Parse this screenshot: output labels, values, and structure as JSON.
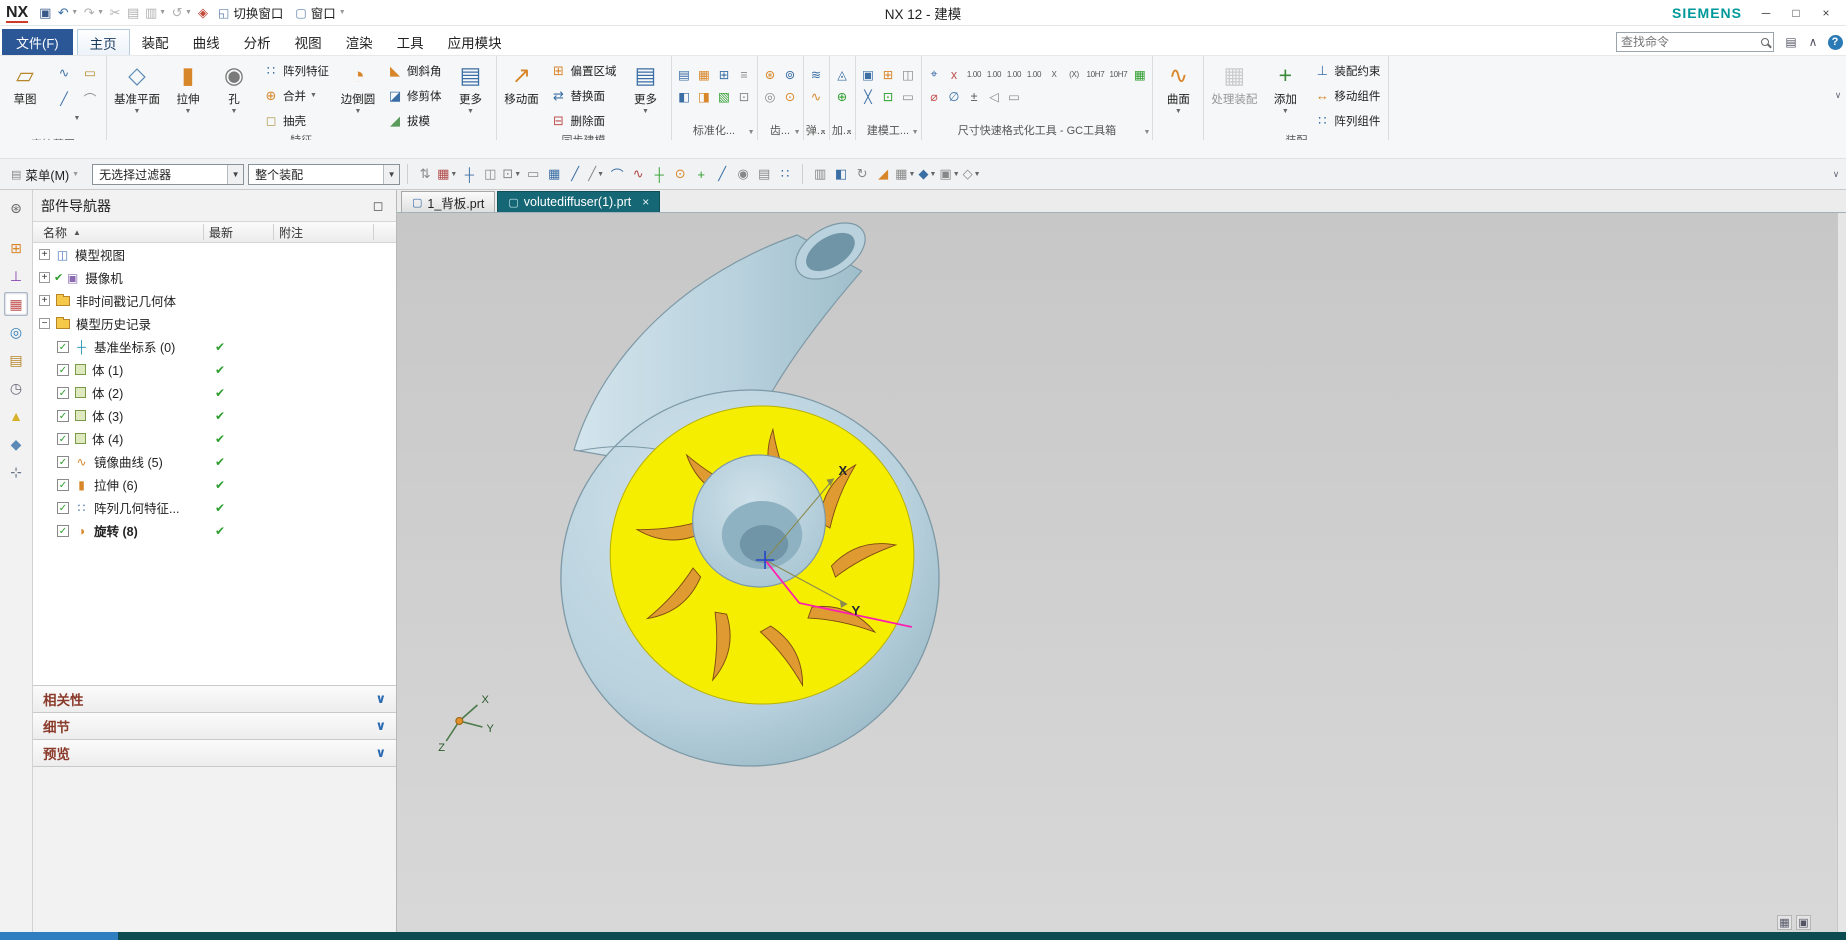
{
  "colors": {
    "brand_teal": "#009999",
    "file_tab_blue": "#2b5797",
    "active_doc_tab": "#156775",
    "check_green": "#2e9e2e",
    "statusbar_teal": "#0d4a52",
    "statusbar_blue": "#2f7fc0",
    "model_body": "#b9d2de",
    "model_body_edge": "#7d99a6",
    "model_face_yellow": "#f6ee00",
    "model_face_edge": "#b8b200",
    "model_blade_orange": "#e09a32",
    "model_blade_edge": "#7a4a12",
    "model_bore": "#6f95a6",
    "highlight_magenta": "#ff1fae"
  },
  "titlebar": {
    "logo": "NX",
    "title": "NX 12 - 建模",
    "brand": "SIEMENS",
    "switch_window": "切换窗口",
    "window_menu": "窗口",
    "controls": [
      "─",
      "□",
      "×"
    ],
    "qat_icons": [
      {
        "name": "save-icon",
        "g": "▣",
        "c": "#3a5a8a"
      },
      {
        "name": "undo-icon",
        "g": "↶",
        "c": "#3a6ea5",
        "caret": true
      },
      {
        "name": "redo-icon",
        "g": "↷",
        "c": "#b0b0b0",
        "caret": true
      },
      {
        "name": "cut-icon",
        "g": "✂",
        "c": "#b0b0b0"
      },
      {
        "name": "copy-icon",
        "g": "▤",
        "c": "#b0b0b0"
      },
      {
        "name": "paste-icon",
        "g": "▥",
        "c": "#b0b0b0",
        "caret": true
      },
      {
        "name": "repeat-command-icon",
        "g": "↺",
        "c": "#b0b0b0",
        "caret": true
      },
      {
        "name": "command-finder-icon",
        "g": "◈",
        "c": "#c04a3a"
      }
    ]
  },
  "tabrow": {
    "file": "文件(F)",
    "tabs": [
      "主页",
      "装配",
      "曲线",
      "分析",
      "视图",
      "渲染",
      "工具",
      "应用模块"
    ],
    "active": "主页",
    "search_placeholder": "查找命令",
    "right_icons": [
      {
        "name": "clipboard-icon",
        "g": "▤"
      },
      {
        "name": "minimize-ribbon-icon",
        "g": "∧"
      },
      {
        "name": "help-icon",
        "g": "?"
      }
    ]
  },
  "ribbon": {
    "groups": [
      {
        "label": "直接草图",
        "caret": true,
        "items": [
          {
            "type": "big",
            "label": "草图",
            "glyph": "▱",
            "color": "#b5862a"
          },
          {
            "type": "grid",
            "icons": [
              {
                "g": "∿",
                "c": "#3a6ea5"
              },
              {
                "g": "▭",
                "c": "#b5862a"
              },
              {
                "g": "╱",
                "c": "#3a6ea5"
              },
              {
                "g": "⌒",
                "c": "#888888"
              }
            ]
          }
        ]
      },
      {
        "label": "特征",
        "caret": true,
        "items": [
          {
            "type": "big",
            "label": "基准平面",
            "glyph": "◇",
            "color": "#5a8ab5",
            "caret": true
          },
          {
            "type": "big",
            "label": "拉伸",
            "glyph": "▮",
            "color": "#d8862a",
            "caret": true
          },
          {
            "type": "big",
            "label": "孔",
            "glyph": "◉",
            "color": "#7a7a7a",
            "caret": true
          },
          {
            "type": "stack",
            "items": [
              {
                "label": "阵列特征",
                "g": "∷",
                "c": "#3a6ea5"
              },
              {
                "label": "合并",
                "g": "⊕",
                "c": "#d8862a",
                "caret": true
              },
              {
                "label": "抽壳",
                "g": "◻",
                "c": "#b5a05a"
              }
            ]
          },
          {
            "type": "big",
            "label": "边倒圆",
            "glyph": "◔",
            "color": "#d8862a",
            "caret": true
          },
          {
            "type": "stack",
            "items": [
              {
                "label": "倒斜角",
                "g": "◣",
                "c": "#d8862a"
              },
              {
                "label": "修剪体",
                "g": "◪",
                "c": "#3a6ea5"
              },
              {
                "label": "拔模",
                "g": "◢",
                "c": "#5a9a5a"
              }
            ]
          },
          {
            "type": "big",
            "label": "更多",
            "glyph": "▤",
            "color": "#3a6ea5",
            "caret": true
          }
        ]
      },
      {
        "label": "同步建模",
        "caret": true,
        "items": [
          {
            "type": "big",
            "label": "移动面",
            "glyph": "↗",
            "color": "#d8862a"
          },
          {
            "type": "stack",
            "items": [
              {
                "label": "偏置区域",
                "g": "⊞",
                "c": "#d8862a"
              },
              {
                "label": "替换面",
                "g": "⇄",
                "c": "#3a6ea5"
              },
              {
                "label": "删除面",
                "g": "⊟",
                "c": "#c05050"
              }
            ]
          },
          {
            "type": "big",
            "label": "更多",
            "glyph": "▤",
            "color": "#3a6ea5",
            "caret": true
          }
        ]
      },
      {
        "label": "标准化...",
        "caret": true,
        "items": [
          {
            "type": "minis",
            "rows": [
              [
                {
                  "g": "▤",
                  "c": "#3a6ea5"
                },
                {
                  "g": "▦",
                  "c": "#d8862a"
                },
                {
                  "g": "⊞",
                  "c": "#3a6ea5"
                },
                {
                  "g": "≡",
                  "c": "#888888"
                }
              ],
              [
                {
                  "g": "◧",
                  "c": "#3a6ea5"
                },
                {
                  "g": "◨",
                  "c": "#d8862a"
                },
                {
                  "g": "▧",
                  "c": "#2e9e2e"
                },
                {
                  "g": "⊡",
                  "c": "#888888"
                }
              ]
            ]
          }
        ]
      },
      {
        "label": "齿...",
        "caret": true,
        "items": [
          {
            "type": "minis",
            "rows": [
              [
                {
                  "g": "⊛",
                  "c": "#d8862a"
                },
                {
                  "g": "⊚",
                  "c": "#3a6ea5"
                }
              ],
              [
                {
                  "g": "◎",
                  "c": "#888888"
                },
                {
                  "g": "⊙",
                  "c": "#d8862a"
                }
              ]
            ]
          }
        ]
      },
      {
        "label": "弹...",
        "caret": true,
        "items": [
          {
            "type": "minis",
            "rows": [
              [
                {
                  "g": "≋",
                  "c": "#3a6ea5"
                }
              ],
              [
                {
                  "g": "∿",
                  "c": "#d8862a"
                }
              ]
            ]
          }
        ]
      },
      {
        "label": "加...",
        "caret": true,
        "items": [
          {
            "type": "minis",
            "rows": [
              [
                {
                  "g": "◬",
                  "c": "#3a6ea5"
                }
              ],
              [
                {
                  "g": "⊕",
                  "c": "#2e9e2e"
                }
              ]
            ]
          }
        ]
      },
      {
        "label": "建模工...",
        "caret": true,
        "items": [
          {
            "type": "minis",
            "rows": [
              [
                {
                  "g": "▣",
                  "c": "#3a6ea5"
                },
                {
                  "g": "⊞",
                  "c": "#d8862a"
                },
                {
                  "g": "◫",
                  "c": "#888888"
                }
              ],
              [
                {
                  "g": "╳",
                  "c": "#3a6ea5"
                },
                {
                  "g": "⊡",
                  "c": "#2e9e2e"
                },
                {
                  "g": "▭",
                  "c": "#888888"
                }
              ]
            ]
          }
        ]
      },
      {
        "label": "尺寸快速格式化工具 - GC工具箱",
        "caret": true,
        "items": [
          {
            "type": "minis",
            "rows": [
              [
                {
                  "g": "⌖",
                  "c": "#3a6ea5"
                },
                {
                  "g": "x",
                  "c": "#c05050"
                },
                {
                  "g": "1.00",
                  "c": "#555",
                  "t": 1
                },
                {
                  "g": "1.00",
                  "c": "#555",
                  "t": 1
                },
                {
                  "g": "1.00",
                  "c": "#555",
                  "t": 1
                },
                {
                  "g": "1.00",
                  "c": "#555",
                  "t": 1
                },
                {
                  "g": "X",
                  "c": "#555",
                  "t": 1
                },
                {
                  "g": "(X)",
                  "c": "#555",
                  "t": 1
                },
                {
                  "g": "10H7",
                  "c": "#555",
                  "t": 1
                },
                {
                  "g": "10H7",
                  "c": "#555",
                  "t": 1
                },
                {
                  "g": "▦",
                  "c": "#2e9e2e"
                }
              ],
              [
                {
                  "g": "⌀",
                  "c": "#c05050"
                },
                {
                  "g": "∅",
                  "c": "#3a6ea5"
                },
                {
                  "g": "±",
                  "c": "#555555"
                },
                {
                  "g": "◁",
                  "c": "#888888"
                },
                {
                  "g": "▭",
                  "c": "#888888"
                }
              ]
            ]
          }
        ]
      },
      {
        "label": "",
        "items": [
          {
            "type": "big",
            "label": "曲面",
            "glyph": "∿",
            "color": "#d8862a",
            "caret": true
          }
        ]
      },
      {
        "label": "装配",
        "caret": true,
        "items": [
          {
            "type": "big",
            "label": "处理装配",
            "glyph": "▦",
            "color": "#999999",
            "disabled": true
          },
          {
            "type": "big",
            "label": "添加",
            "glyph": "+",
            "color": "#3a8a3a",
            "caret": true
          },
          {
            "type": "stack",
            "items": [
              {
                "label": "装配约束",
                "g": "⊥",
                "c": "#3a6ea5"
              },
              {
                "label": "移动组件",
                "g": "↔",
                "c": "#d8862a"
              },
              {
                "label": "阵列组件",
                "g": "∷",
                "c": "#3a6ea5"
              }
            ]
          }
        ]
      }
    ]
  },
  "toolrow": {
    "menu": "菜单(M)",
    "filter": "无选择过滤器",
    "scope": "整个装配",
    "icons1": [
      {
        "g": "⇅",
        "c": "#888888"
      },
      {
        "g": "▦",
        "c": "#b04a4a",
        "caret": true
      },
      {
        "g": "┼",
        "c": "#3a6ea5"
      },
      {
        "g": "◫",
        "c": "#888888"
      },
      {
        "g": "⊡",
        "c": "#888888",
        "caret": true
      },
      {
        "g": "▭",
        "c": "#888888"
      },
      {
        "g": "▦",
        "c": "#3a6ea5"
      },
      {
        "g": "╱",
        "c": "#3a6ea5"
      },
      {
        "g": "╱",
        "c": "#888888",
        "caret": true
      },
      {
        "g": "⌒",
        "c": "#3a6ea5"
      },
      {
        "g": "∿",
        "c": "#b04a4a"
      },
      {
        "g": "┼",
        "c": "#2e9e2e"
      },
      {
        "g": "⊙",
        "c": "#d8862a"
      },
      {
        "g": "+",
        "c": "#2e9e2e"
      },
      {
        "g": "╱",
        "c": "#3a6ea5"
      },
      {
        "g": "◉",
        "c": "#888888"
      },
      {
        "g": "▤",
        "c": "#888888"
      },
      {
        "g": "∷",
        "c": "#3a6ea5"
      }
    ],
    "icons2": [
      {
        "g": "▥",
        "c": "#888888"
      },
      {
        "g": "◧",
        "c": "#3a6ea5"
      },
      {
        "g": "↻",
        "c": "#888888"
      },
      {
        "g": "◢",
        "c": "#d8862a"
      },
      {
        "g": "▦",
        "c": "#888888",
        "caret": true
      },
      {
        "g": "◆",
        "c": "#3a6ea5",
        "caret": true
      },
      {
        "g": "▣",
        "c": "#888888",
        "caret": true
      },
      {
        "g": "◇",
        "c": "#888888",
        "caret": true
      }
    ]
  },
  "sidebar": {
    "icons": [
      {
        "name": "navigator-settings-gear-icon",
        "g": "⊛",
        "c": "#666666",
        "gear": true
      },
      {
        "name": "assembly-navigator-icon",
        "g": "⊞",
        "c": "#d8862a"
      },
      {
        "name": "constraint-navigator-icon",
        "g": "⊥",
        "c": "#8a4ab0"
      },
      {
        "name": "part-navigator-icon",
        "g": "▦",
        "c": "#c05050",
        "active": true
      },
      {
        "name": "web-browser-icon",
        "g": "◎",
        "c": "#2a7ab5"
      },
      {
        "name": "notebook-icon",
        "g": "▤",
        "c": "#b5862a"
      },
      {
        "name": "history-icon",
        "g": "◷",
        "c": "#666677"
      },
      {
        "name": "system-scenes-icon",
        "g": "▲",
        "c": "#d8b02a"
      },
      {
        "name": "roles-icon",
        "g": "◆",
        "c": "#5a8ab5"
      },
      {
        "name": "utilities-icon",
        "g": "⊹",
        "c": "#667788"
      }
    ]
  },
  "navigator": {
    "title": "部件导航器",
    "columns": {
      "name": "名称",
      "sort": "▲",
      "latest": "最新",
      "note": "附注"
    },
    "rows": [
      {
        "expander": "+",
        "icon": "model-views",
        "label": "模型视图"
      },
      {
        "expander": "+",
        "icon": "camera",
        "label": "摄像机",
        "precheck": true
      },
      {
        "expander": "+",
        "icon": "folder",
        "label": "非时间戳记几何体"
      },
      {
        "expander": "−",
        "icon": "folder-open",
        "label": "模型历史记录"
      },
      {
        "checkbox": true,
        "icon": "csys",
        "label": "基准坐标系 (0)",
        "latest": "✔"
      },
      {
        "checkbox": true,
        "icon": "body",
        "label": "体 (1)",
        "latest": "✔"
      },
      {
        "checkbox": true,
        "icon": "body",
        "label": "体 (2)",
        "latest": "✔"
      },
      {
        "checkbox": true,
        "icon": "body",
        "label": "体 (3)",
        "latest": "✔"
      },
      {
        "checkbox": true,
        "icon": "body",
        "label": "体 (4)",
        "latest": "✔"
      },
      {
        "checkbox": true,
        "icon": "mirror-curve",
        "label": "镜像曲线 (5)",
        "latest": "✔"
      },
      {
        "checkbox": true,
        "icon": "extrude",
        "label": "拉伸 (6)",
        "latest": "✔"
      },
      {
        "checkbox": true,
        "icon": "pattern",
        "label": "阵列几何特征...",
        "latest": "✔"
      },
      {
        "checkbox": true,
        "icon": "revolve",
        "label": "旋转 (8)",
        "latest": "✔",
        "bold": true
      }
    ],
    "sections": [
      "相关性",
      "细节",
      "预览"
    ]
  },
  "viewport": {
    "doc_tabs": [
      {
        "label": "1_背板.prt",
        "active": false
      },
      {
        "label": "volutediffuser(1).prt",
        "active": true,
        "close": "×"
      }
    ],
    "axes": {
      "x": "X",
      "y": "Y"
    },
    "triad": {
      "x": "X",
      "y": "Y",
      "z": "Z"
    },
    "corner_icons": [
      "▦",
      "▣"
    ]
  }
}
